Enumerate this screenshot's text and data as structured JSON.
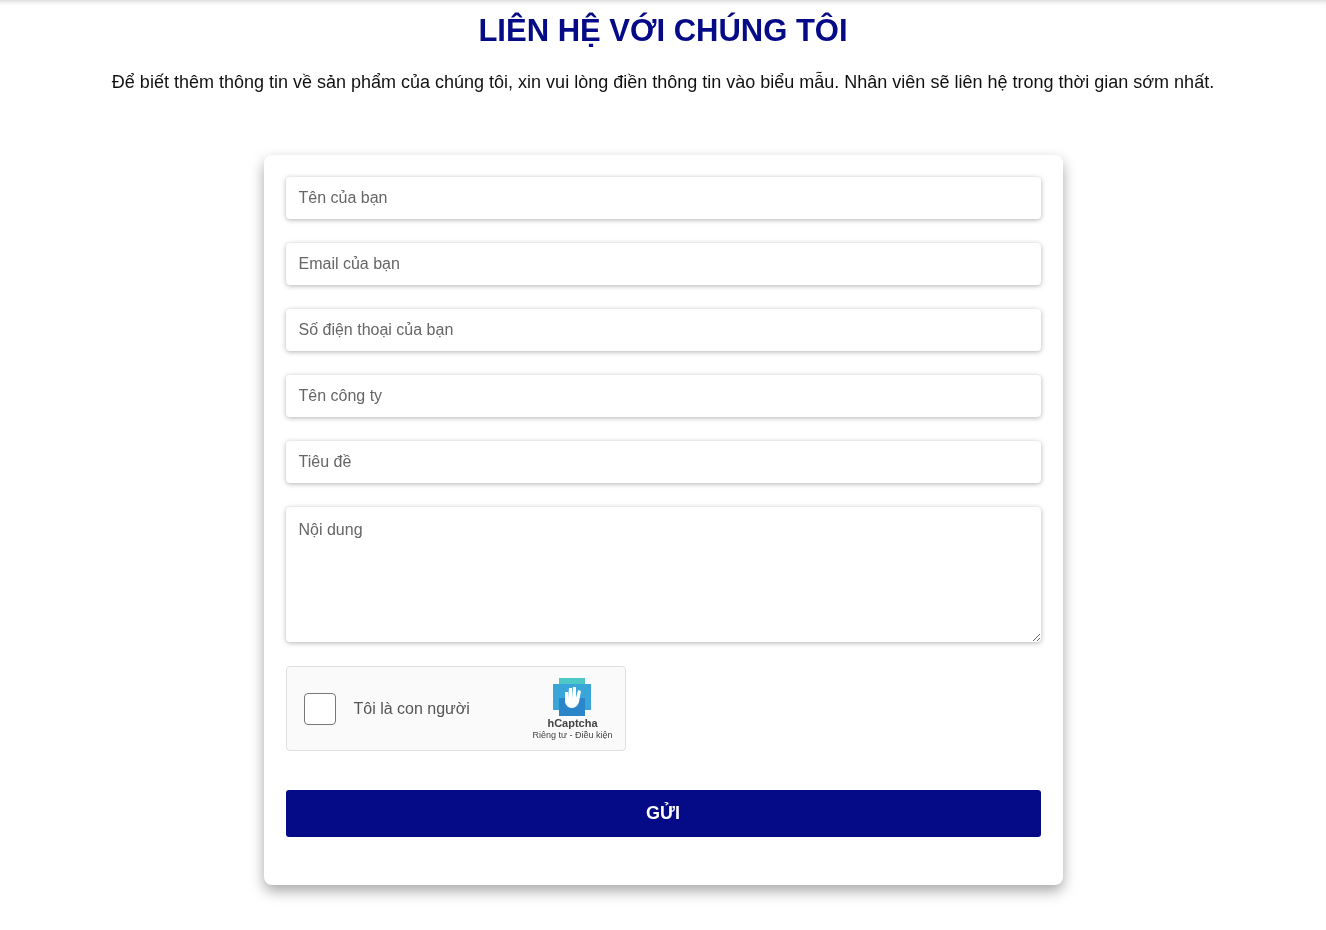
{
  "title": "LIÊN HỆ VỚI CHÚNG TÔI",
  "intro": "Để biết thêm thông tin về sản phẩm của chúng tôi, xin vui lòng điền thông tin vào biểu mẫu. Nhân viên sẽ liên hệ trong thời gian sớm nhất.",
  "fields": [
    {
      "kind": "input",
      "placeholder": "Tên của bạn"
    },
    {
      "kind": "input",
      "placeholder": "Email của bạn"
    },
    {
      "kind": "input",
      "placeholder": "Số điện thoại của bạn"
    },
    {
      "kind": "input",
      "placeholder": "Tên công ty"
    },
    {
      "kind": "input",
      "placeholder": "Tiêu đề"
    },
    {
      "kind": "textarea",
      "placeholder": "Nội dung"
    }
  ],
  "captcha": {
    "checked": false,
    "label": "Tôi là con người",
    "brand": "hCaptcha",
    "links": "Riêng tư - Điều kiện"
  },
  "submit": "GỬI"
}
